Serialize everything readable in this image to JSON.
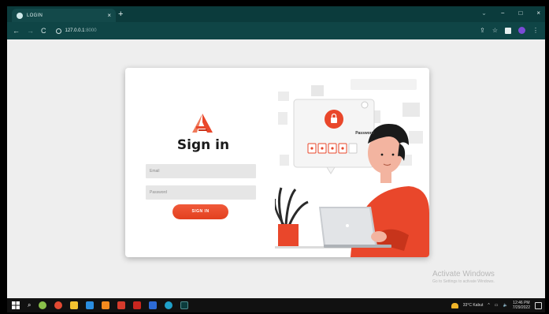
{
  "browser": {
    "tab_title": "LOGIN",
    "tab_close": "×",
    "new_tab": "+",
    "url_host": "127.0.0.1",
    "url_port": ":8000",
    "win_menu": "⌄",
    "win_min": "−",
    "win_max": "□",
    "win_close": "×",
    "back": "←",
    "forward": "→",
    "reload": "C"
  },
  "login": {
    "title": "Sign in",
    "email_placeholder": "Email",
    "password_placeholder": "Password",
    "signin_label": "SIGN IN"
  },
  "illustration": {
    "popup_label": "Password"
  },
  "watermark": {
    "title": "Activate Windows",
    "subtitle": "Go to Settings to activate Windows."
  },
  "taskbar": {
    "weather": "33°C Kabut",
    "time": "12:46 PM",
    "date": "7/29/2022"
  },
  "colors": {
    "accent": "#e9472b",
    "chrome": "#0b3b3c"
  }
}
